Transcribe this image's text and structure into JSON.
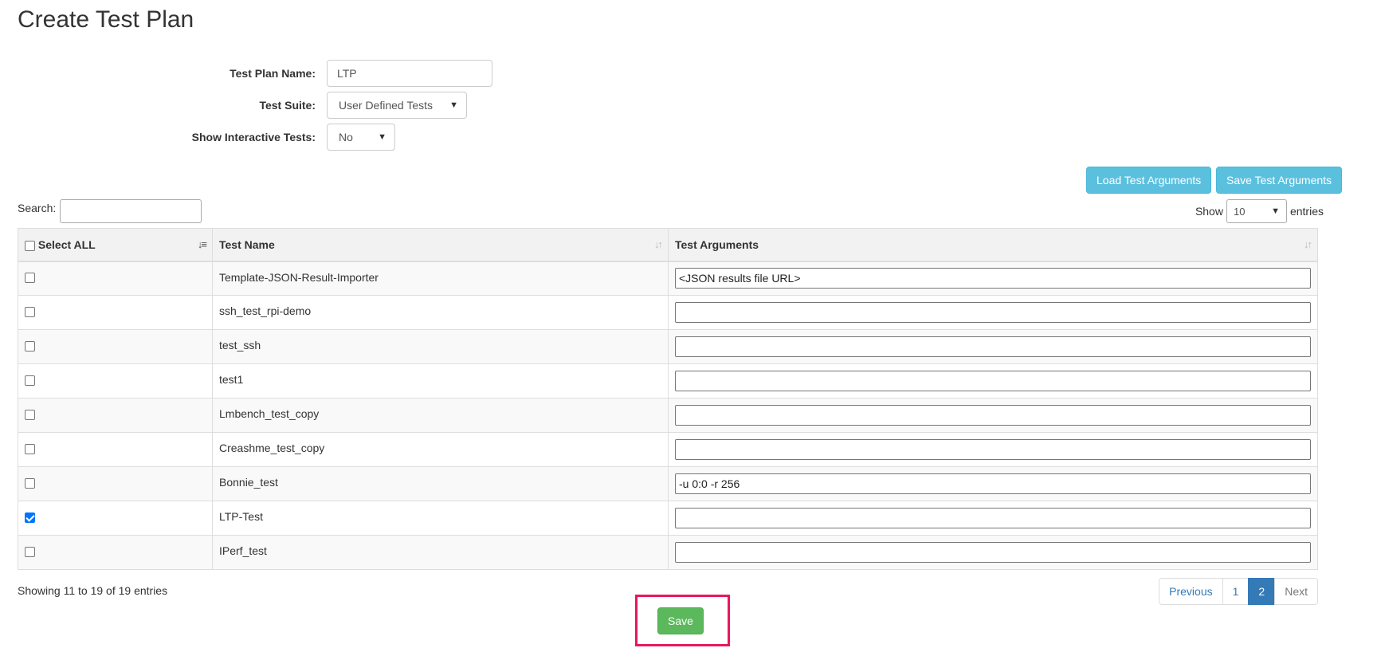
{
  "page": {
    "title": "Create Test Plan"
  },
  "form": {
    "plan_name_label": "Test Plan Name:",
    "plan_name_value": "LTP",
    "suite_label": "Test Suite:",
    "suite_value": "User Defined Tests",
    "interactive_label": "Show Interactive Tests:",
    "interactive_value": "No"
  },
  "toolbar": {
    "load_args": "Load Test Arguments",
    "save_args": "Save Test Arguments"
  },
  "table_controls": {
    "search_label": "Search:",
    "search_value": "",
    "show_label": "Show",
    "page_length": "10",
    "entries_label": "entries"
  },
  "table": {
    "columns": [
      "Select ALL",
      "Test Name",
      "Test Arguments"
    ],
    "rows": [
      {
        "checked": false,
        "name": "Template-JSON-Result-Importer",
        "args": "<JSON results file URL>"
      },
      {
        "checked": false,
        "name": "ssh_test_rpi-demo",
        "args": ""
      },
      {
        "checked": false,
        "name": "test_ssh",
        "args": ""
      },
      {
        "checked": false,
        "name": "test1",
        "args": ""
      },
      {
        "checked": false,
        "name": "Lmbench_test_copy",
        "args": ""
      },
      {
        "checked": false,
        "name": "Creashme_test_copy",
        "args": ""
      },
      {
        "checked": false,
        "name": "Bonnie_test",
        "args": "-u 0:0 -r 256"
      },
      {
        "checked": true,
        "name": "LTP-Test",
        "args": ""
      },
      {
        "checked": false,
        "name": "IPerf_test",
        "args": ""
      }
    ]
  },
  "footer": {
    "info": "Showing 11 to 19 of 19 entries",
    "pagination": {
      "previous": "Previous",
      "page1": "1",
      "page2": "2",
      "next": "Next"
    },
    "save_button": "Save"
  },
  "colors": {
    "info_button": "#5bc0de",
    "save_button": "#5cb85c",
    "active_page": "#337ab7",
    "highlight_box": "#e8175d"
  }
}
